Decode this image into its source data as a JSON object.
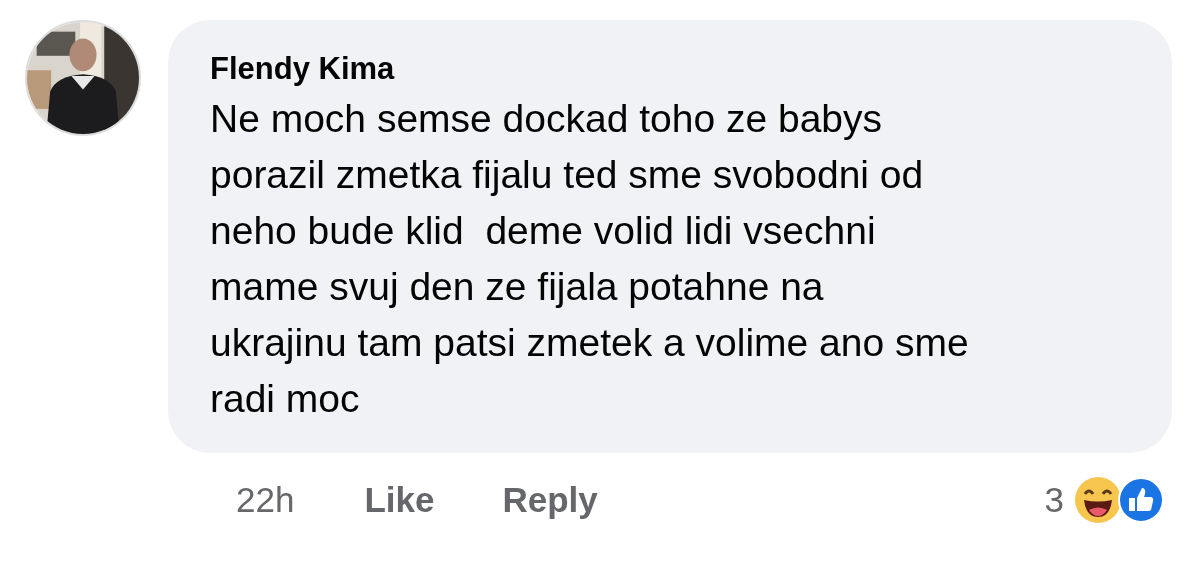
{
  "comment": {
    "author": "Flendy Kima",
    "text": "Ne moch semse dockad toho ze babys\nporazil zmetka fijalu ted sme svobodni od\nneho bude klid  deme volid lidi vsechni\nmame svuj den ze fijala potahne na\nukrajinu tam patsi zmetek a volime ano sme\nradi moc",
    "time": "22h",
    "actions": [
      "Like",
      "Reply"
    ],
    "reaction_count": "3"
  }
}
